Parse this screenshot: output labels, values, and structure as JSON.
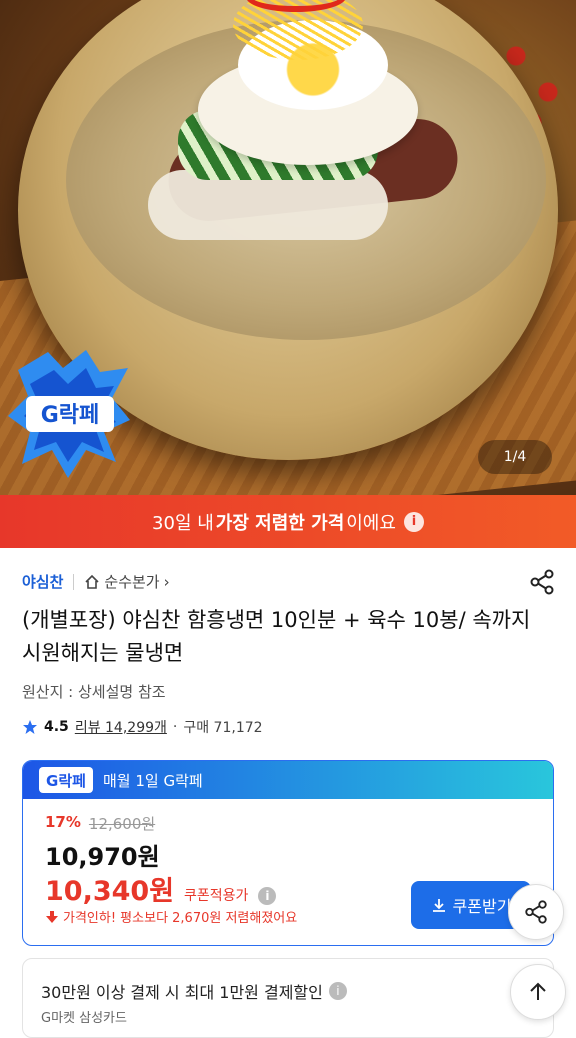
{
  "hero": {
    "counter": "1/4",
    "badge_text": "G락페"
  },
  "banner": {
    "pre": "30일 내 ",
    "bold": "가장 저렴한 가격",
    "post": "이에요",
    "info_icon": "info-icon"
  },
  "meta": {
    "brand": "야심찬",
    "shop": "순수본가",
    "shop_chevron": "›"
  },
  "product": {
    "title": "(개별포장) 야심찬 함흥냉면 10인분  + 육수 10봉/ 속까지 시원해지는 물냉면",
    "origin": "원산지 : 상세설명 참조",
    "rating": "4.5",
    "reviews": "리뷰 14,299개",
    "purchases": "구매 71,172",
    "rating_sep": "·"
  },
  "promo": {
    "logo": "G락페",
    "header": "매월 1일 G락페",
    "discount_pct": "17%",
    "orig_price": "12,600원",
    "price": "10,970원",
    "coupon_price": "10,340원",
    "coupon_label": "쿠폰적용가",
    "alert": "가격인하! 평소보다 2,670원 저렴해졌어요",
    "coupon_button": "쿠폰받기"
  },
  "payment": {
    "title": "30만원 이상 결제 시 최대 1만원 결제할인",
    "subtitle": "G마켓 삼성카드"
  },
  "colors": {
    "accent": "#e7372a",
    "brand_blue": "#1d6de8"
  }
}
